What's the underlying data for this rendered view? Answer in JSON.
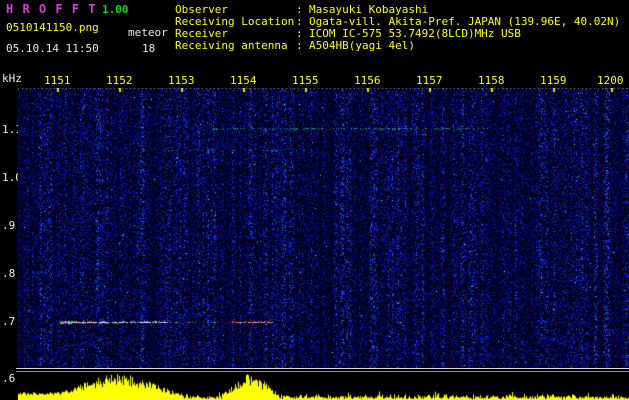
{
  "header": {
    "app_title": "H R O F F T",
    "version": "1.00",
    "filename": "0510141150.png",
    "mode": "meteor",
    "datetime": "05.10.14 11:50",
    "count": "18",
    "separator": ":",
    "info": [
      {
        "label": "Observer",
        "value": "Masayuki Kobayashi"
      },
      {
        "label": "Receiving Location",
        "value": "Ogata-vill. Akita-Pref. JAPAN (139.96E, 40.02N)"
      },
      {
        "label": "Receiver",
        "value": "ICOM IC-575 53.7492(8LCD)MHz USB"
      },
      {
        "label": "Receiving antenna",
        "value": "A504HB(yagi 4el)"
      }
    ]
  },
  "spectrogram": {
    "freq_axis_unit": "kHz",
    "freq_labels": [
      "1.1",
      "1.0",
      ".9",
      ".8",
      ".7",
      ".6"
    ],
    "time_labels": [
      "1151",
      "1152",
      "1153",
      "1154",
      "1155",
      "1156",
      "1157",
      "1158",
      "1159",
      "1200"
    ],
    "theme": {
      "title_color": "#cc44cc",
      "version_color": "#00dd00",
      "label_yellow": "#ffff00",
      "label_white": "#f0f0f0",
      "background": "#000000",
      "spectrogram_background": "#00001a",
      "noise_blue": "#2244ee",
      "trace_white": "#ebd7cd",
      "amplitude_yellow": "#ffff00",
      "separator_line": "#d8d8d8"
    }
  }
}
